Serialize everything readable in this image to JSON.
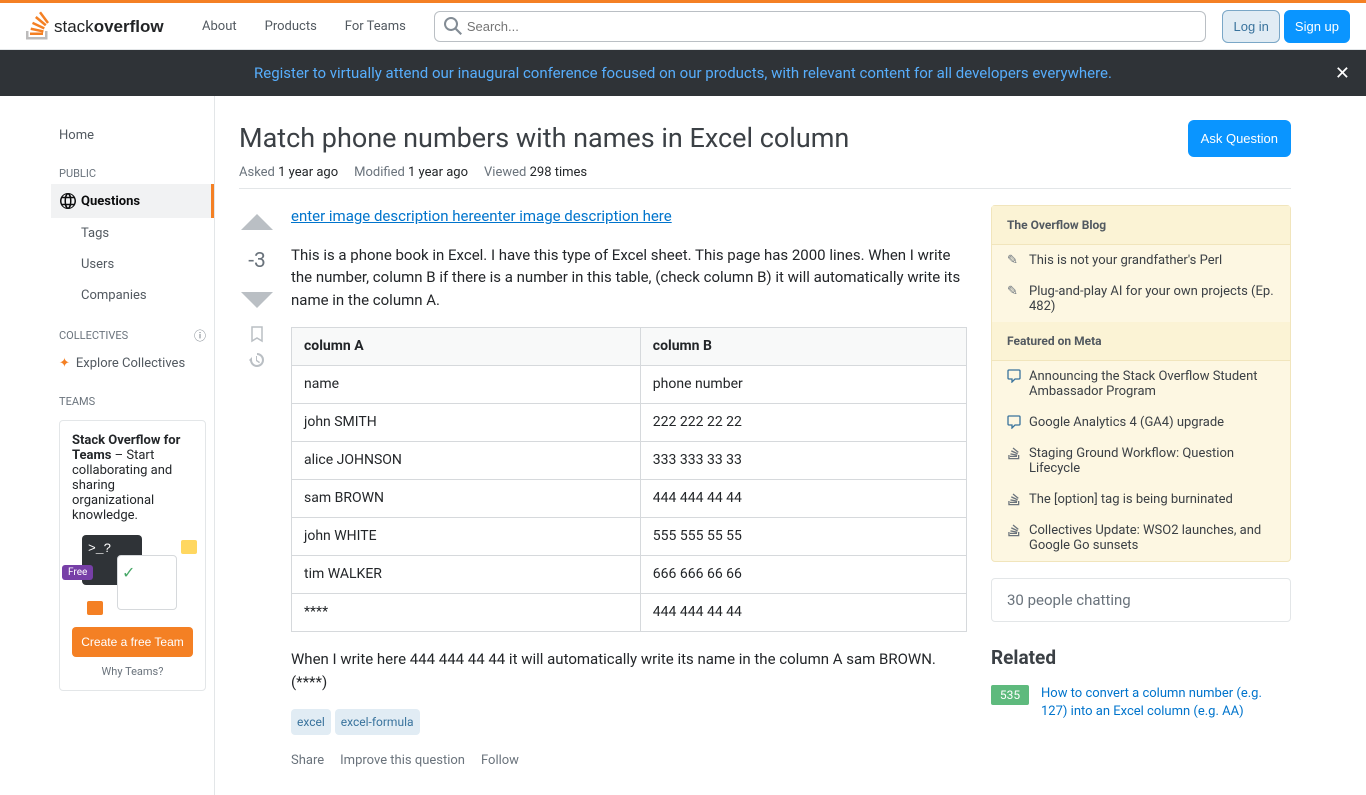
{
  "header": {
    "nav": [
      "About",
      "Products",
      "For Teams"
    ],
    "search_placeholder": "Search...",
    "login": "Log in",
    "signup": "Sign up"
  },
  "banner": {
    "text": "Register to virtually attend our inaugural conference focused on our products, with relevant content for all developers everywhere."
  },
  "sidebar": {
    "home": "Home",
    "public": "PUBLIC",
    "questions": "Questions",
    "tags": "Tags",
    "users": "Users",
    "companies": "Companies",
    "collectives": "COLLECTIVES",
    "explore": "Explore Collectives",
    "teams": "TEAMS",
    "teams_title": "Stack Overflow for Teams",
    "teams_desc": " – Start collaborating and sharing organizational knowledge.",
    "teams_free": "Free",
    "teams_terminal": ">_?",
    "create_team": "Create a free Team",
    "why_teams": "Why Teams?"
  },
  "question": {
    "title": "Match phone numbers with names in Excel column",
    "ask": "Ask Question",
    "asked_label": "Asked",
    "asked_value": "1 year ago",
    "modified_label": "Modified",
    "modified_value": "1 year ago",
    "viewed_label": "Viewed",
    "viewed_value": "298 times",
    "vote": "-3",
    "img_link": "enter image description hereenter image description here",
    "body1": "This is a phone book in Excel. I have this type of Excel sheet. This page has 2000 lines. When I write the number, column B if there is a number in this table, (check column B) it will automatically write its name in the column A.",
    "body2": "When I write here 444 444 44 44 it will automatically write its name in the column A sam BROWN. (****)",
    "table_headers": [
      "column A",
      "column B"
    ],
    "table_rows": [
      [
        "name",
        "phone number"
      ],
      [
        "john SMITH",
        "222 222 22 22"
      ],
      [
        "alice JOHNSON",
        "333 333 33 33"
      ],
      [
        "sam BROWN",
        "444 444 44 44"
      ],
      [
        "john WHITE",
        "555 555 55 55"
      ],
      [
        "tim WALKER",
        "666 666 66 66"
      ],
      [
        "****",
        "444 444 44 44"
      ]
    ],
    "tags": [
      "excel",
      "excel-formula"
    ],
    "actions": [
      "Share",
      "Improve this question",
      "Follow"
    ]
  },
  "right": {
    "blog_title": "The Overflow Blog",
    "blog_items": [
      "This is not your grandfather's Perl",
      "Plug-and-play AI for your own projects (Ep. 482)"
    ],
    "meta_title": "Featured on Meta",
    "meta_items": [
      "Announcing the Stack Overflow Student Ambassador Program",
      "Google Analytics 4 (GA4) upgrade",
      "Staging Ground Workflow: Question Lifecycle",
      "The [option] tag is being burninated",
      "Collectives Update: WSO2 launches, and Google Go sunsets"
    ],
    "chat": "30 people chatting",
    "related_title": "Related",
    "related": [
      {
        "score": "535",
        "title": "How to convert a column number (e.g. 127) into an Excel column (e.g. AA)"
      }
    ]
  }
}
